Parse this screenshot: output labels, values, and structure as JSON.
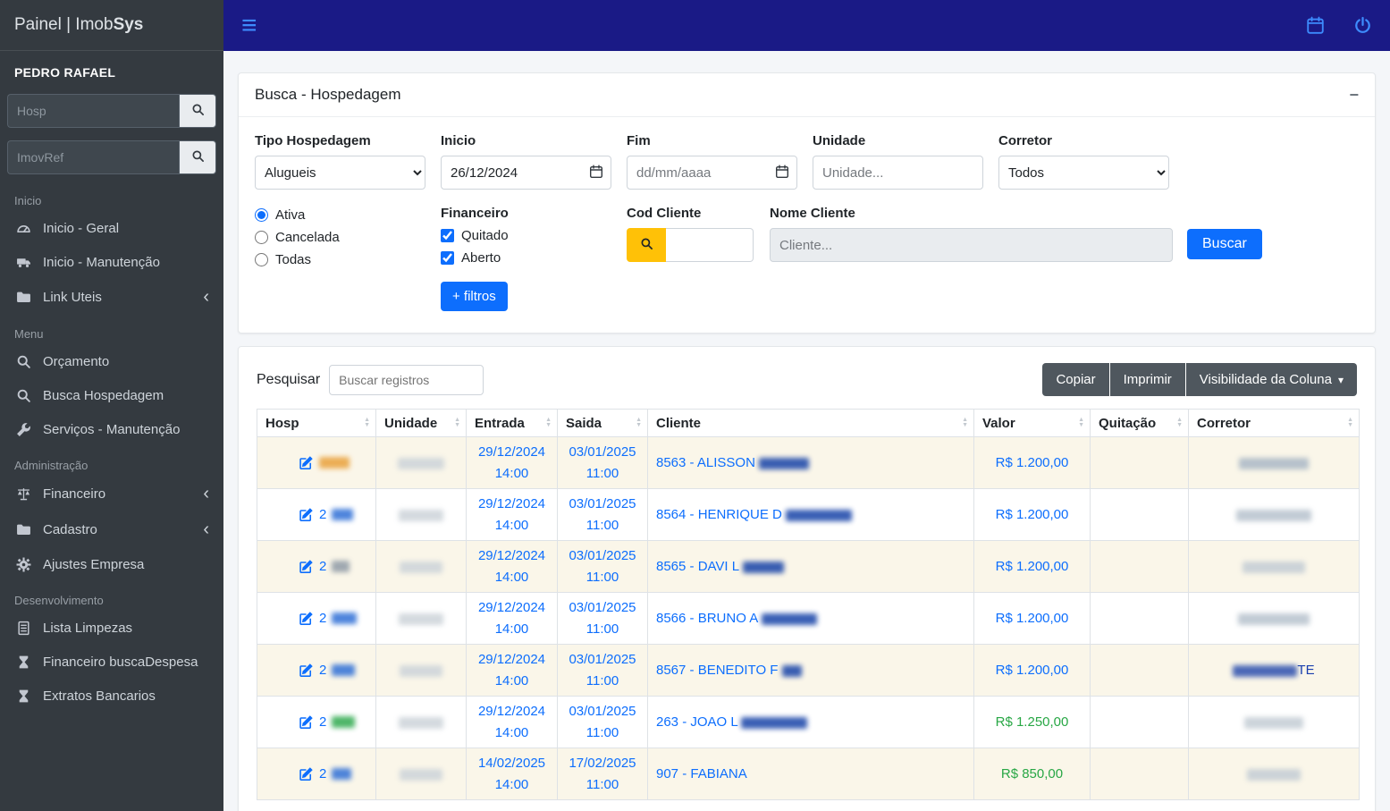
{
  "colors": {
    "accent": "#0d6efd",
    "navbar": "#1a1a86",
    "sidebar": "#343a40",
    "warning": "#ffc107",
    "success": "#28a745",
    "link_blue": "#0d6efd"
  },
  "sidebar": {
    "brand_prefix": "Painel | Imob",
    "brand_bold": "Sys",
    "user": "PEDRO RAFAEL",
    "search_hosp_placeholder": "Hosp",
    "search_imovref_placeholder": "ImovRef",
    "sections": [
      {
        "label": "Inicio",
        "items": [
          {
            "label": "Inicio - Geral",
            "icon": "dashboard-icon",
            "chevron": false
          },
          {
            "label": "Inicio - Manutenção",
            "icon": "truck-icon",
            "chevron": false
          },
          {
            "label": "Link Uteis",
            "icon": "folder-icon",
            "chevron": true
          }
        ]
      },
      {
        "label": "Menu",
        "items": [
          {
            "label": "Orçamento",
            "icon": "search-icon",
            "chevron": false
          },
          {
            "label": "Busca Hospedagem",
            "icon": "search-icon",
            "chevron": false
          },
          {
            "label": "Serviços - Manutenção",
            "icon": "wrench-icon",
            "chevron": false
          }
        ]
      },
      {
        "label": "Administração",
        "items": [
          {
            "label": "Financeiro",
            "icon": "balance-icon",
            "chevron": true
          },
          {
            "label": "Cadastro",
            "icon": "folder-icon",
            "chevron": true
          },
          {
            "label": "Ajustes Empresa",
            "icon": "gear-icon",
            "chevron": false
          }
        ]
      },
      {
        "label": "Desenvolvimento",
        "items": [
          {
            "label": "Lista Limpezas",
            "icon": "list-icon",
            "chevron": false
          },
          {
            "label": "Financeiro buscaDespesa",
            "icon": "hourglass-icon",
            "chevron": false
          },
          {
            "label": "Extratos Bancarios",
            "icon": "hourglass-icon",
            "chevron": false
          }
        ]
      }
    ]
  },
  "search_card": {
    "title": "Busca - Hospedagem",
    "tipo_label": "Tipo Hospedagem",
    "tipo_value": "Alugueis",
    "inicio_label": "Inicio",
    "inicio_value": "26/12/2024",
    "fim_label": "Fim",
    "fim_placeholder": "dd/mm/aaaa",
    "unidade_label": "Unidade",
    "unidade_placeholder": "Unidade...",
    "corretor_label": "Corretor",
    "corretor_value": "Todos",
    "radios": [
      {
        "label": "Ativa",
        "checked": true
      },
      {
        "label": "Cancelada",
        "checked": false
      },
      {
        "label": "Todas",
        "checked": false
      }
    ],
    "financeiro_label": "Financeiro",
    "checkboxes": [
      {
        "label": "Quitado",
        "checked": true
      },
      {
        "label": "Aberto",
        "checked": true
      }
    ],
    "filtros_button": "+ filtros",
    "cod_cliente_label": "Cod Cliente",
    "nome_cliente_label": "Nome Cliente",
    "nome_cliente_placeholder": "Cliente...",
    "buscar_button": "Buscar"
  },
  "table_card": {
    "pesquisar_label": "Pesquisar",
    "pesquisar_placeholder": "Buscar registros",
    "buttons": [
      {
        "label": "Copiar",
        "caret": false
      },
      {
        "label": "Imprimir",
        "caret": false
      },
      {
        "label": "Visibilidade da Coluna",
        "caret": true
      }
    ],
    "columns": [
      "Hosp",
      "Unidade",
      "Entrada",
      "Saida",
      "Cliente",
      "Valor",
      "Quitação",
      "Corretor"
    ],
    "rows": [
      {
        "hosp_prefix": "",
        "hosp_blob": "#e9a13b",
        "hosp_blob_w": 34,
        "unidade_blob_w": 52,
        "entrada_date": "29/12/2024",
        "entrada_time": "14:00",
        "saida_date": "03/01/2025",
        "saida_time": "11:00",
        "cliente": "8563 - ALISSON ",
        "cliente_blob_w": 56,
        "valor": "R$ 1.200,00",
        "valor_color": "#0d6efd",
        "quitacao": "",
        "corretor_text": "",
        "corretor_blob": "#aab8c6",
        "corretor_blob_w": 78
      },
      {
        "hosp_prefix": "2",
        "hosp_blob": "#2f6fd6",
        "hosp_blob_w": 24,
        "unidade_blob_w": 50,
        "entrada_date": "29/12/2024",
        "entrada_time": "14:00",
        "saida_date": "03/01/2025",
        "saida_time": "11:00",
        "cliente": "8564 - HENRIQUE D",
        "cliente_blob_w": 74,
        "valor": "R$ 1.200,00",
        "valor_color": "#0d6efd",
        "quitacao": "",
        "corretor_text": "",
        "corretor_blob": "#b7c2cd",
        "corretor_blob_w": 84
      },
      {
        "hosp_prefix": "2",
        "hosp_blob": "#8f9aa6",
        "hosp_blob_w": 20,
        "unidade_blob_w": 48,
        "entrada_date": "29/12/2024",
        "entrada_time": "14:00",
        "saida_date": "03/01/2025",
        "saida_time": "11:00",
        "cliente": "8565 - DAVI L",
        "cliente_blob_w": 46,
        "valor": "R$ 1.200,00",
        "valor_color": "#0d6efd",
        "quitacao": "",
        "corretor_text": "",
        "corretor_blob": "#c3ccd4",
        "corretor_blob_w": 70
      },
      {
        "hosp_prefix": "2",
        "hosp_blob": "#2f6fd6",
        "hosp_blob_w": 28,
        "unidade_blob_w": 50,
        "entrada_date": "29/12/2024",
        "entrada_time": "14:00",
        "saida_date": "03/01/2025",
        "saida_time": "11:00",
        "cliente": "8566 - BRUNO A",
        "cliente_blob_w": 62,
        "valor": "R$ 1.200,00",
        "valor_color": "#0d6efd",
        "quitacao": "",
        "corretor_text": "",
        "corretor_blob": "#b7c2cd",
        "corretor_blob_w": 80
      },
      {
        "hosp_prefix": "2",
        "hosp_blob": "#2f6fd6",
        "hosp_blob_w": 26,
        "unidade_blob_w": 48,
        "entrada_date": "29/12/2024",
        "entrada_time": "14:00",
        "saida_date": "03/01/2025",
        "saida_time": "11:00",
        "cliente": "8567 - BENEDITO F",
        "cliente_blob_w": 22,
        "valor": "R$ 1.200,00",
        "valor_color": "#0d6efd",
        "quitacao": "",
        "corretor_text": "TE",
        "corretor_blob": "#2c4fae",
        "corretor_blob_w": 72
      },
      {
        "hosp_prefix": "2",
        "hosp_blob": "#2faa4e",
        "hosp_blob_w": 26,
        "unidade_blob_w": 50,
        "entrada_date": "29/12/2024",
        "entrada_time": "14:00",
        "saida_date": "03/01/2025",
        "saida_time": "11:00",
        "cliente": "263 - JOAO L",
        "cliente_blob_w": 74,
        "valor": "R$ 1.250,00",
        "valor_color": "#28a745",
        "quitacao": "",
        "corretor_text": "",
        "corretor_blob": "#c3ccd4",
        "corretor_blob_w": 66
      },
      {
        "hosp_prefix": "2",
        "hosp_blob": "#2f6fd6",
        "hosp_blob_w": 22,
        "unidade_blob_w": 48,
        "entrada_date": "14/02/2025",
        "entrada_time": "14:00",
        "saida_date": "17/02/2025",
        "saida_time": "11:00",
        "cliente": "907 - FABIANA ",
        "cliente_blob_w": 0,
        "valor": "R$ 850,00",
        "valor_color": "#28a745",
        "quitacao": "",
        "corretor_text": "",
        "corretor_blob": "#c3ccd4",
        "corretor_blob_w": 60
      }
    ]
  }
}
